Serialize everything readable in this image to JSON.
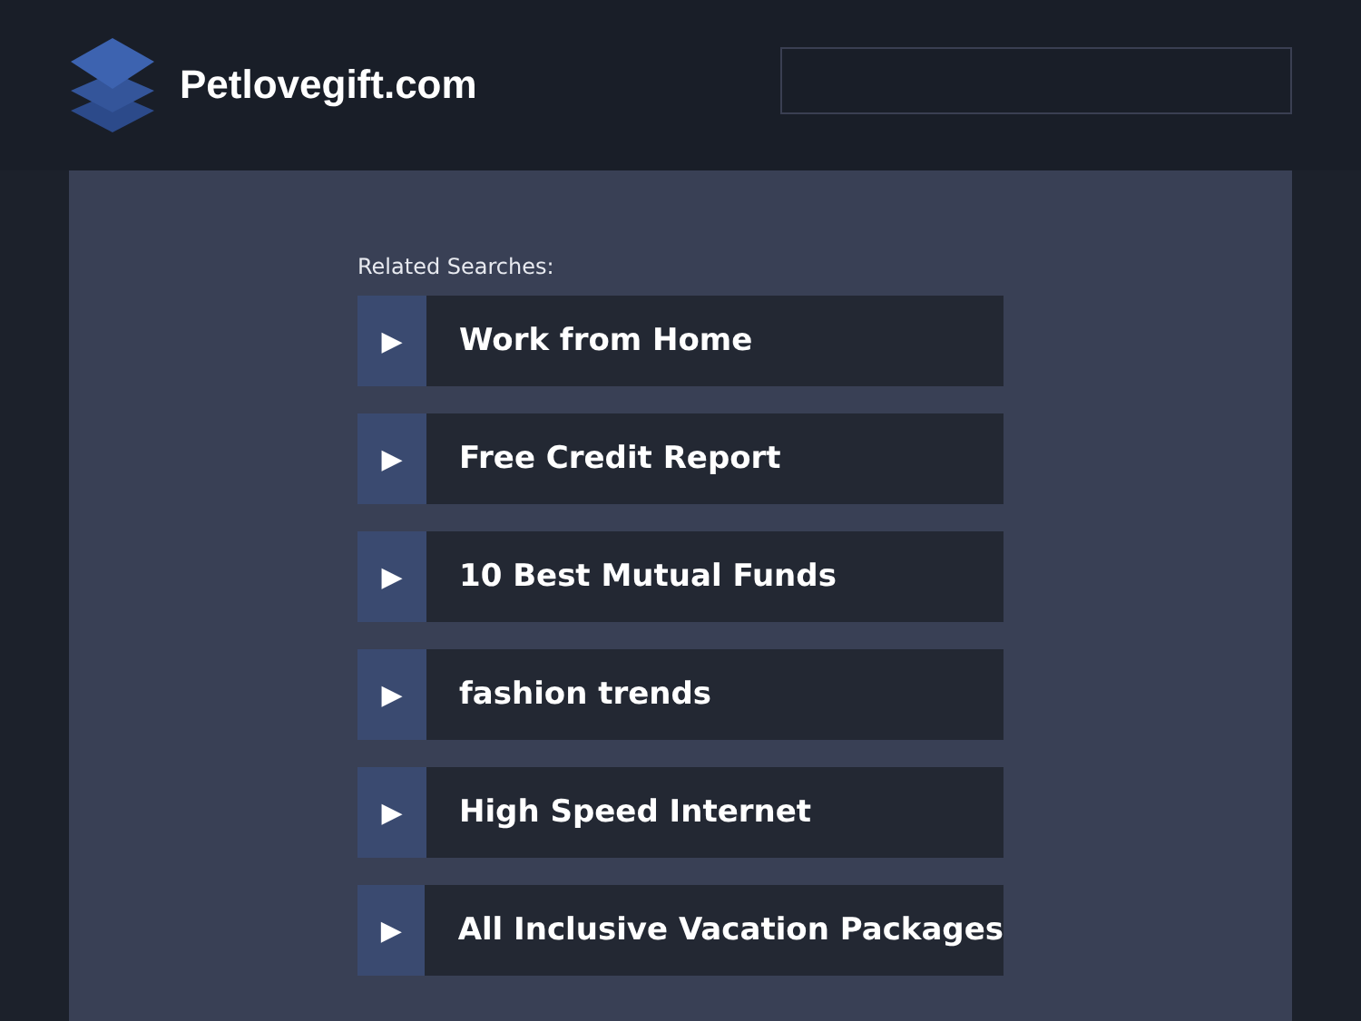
{
  "header": {
    "site_name": "Petlovegift.com"
  },
  "related": {
    "label": "Related Searches:",
    "items": [
      {
        "text": "Work from Home",
        "icon": "▶"
      },
      {
        "text": "Free Credit Report",
        "icon": "▶"
      },
      {
        "text": "10 Best Mutual Funds",
        "icon": "▶"
      },
      {
        "text": "fashion trends",
        "icon": "▶"
      },
      {
        "text": "High Speed Internet",
        "icon": "▶"
      },
      {
        "text": "All Inclusive Vacation Packages",
        "icon": "▶"
      }
    ]
  }
}
